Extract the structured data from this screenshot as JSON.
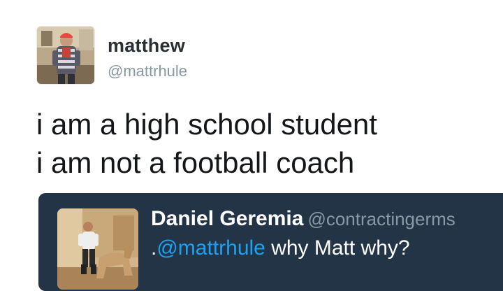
{
  "tweet": {
    "author": {
      "display_name": "matthew",
      "handle": "@mattrhule"
    },
    "text_lines": [
      "i am a high school student",
      "i am not a football coach"
    ],
    "quoted": {
      "author": {
        "display_name": "Daniel Geremia",
        "handle": "@contractingerms"
      },
      "text_prefix": ".",
      "mention": "@mattrhule",
      "text_suffix": " why Matt why?"
    }
  },
  "colors": {
    "name": "#292f33",
    "handle": "#8899a6",
    "text": "#14171a",
    "quote_bg": "#243447",
    "link": "#1da1f2"
  }
}
